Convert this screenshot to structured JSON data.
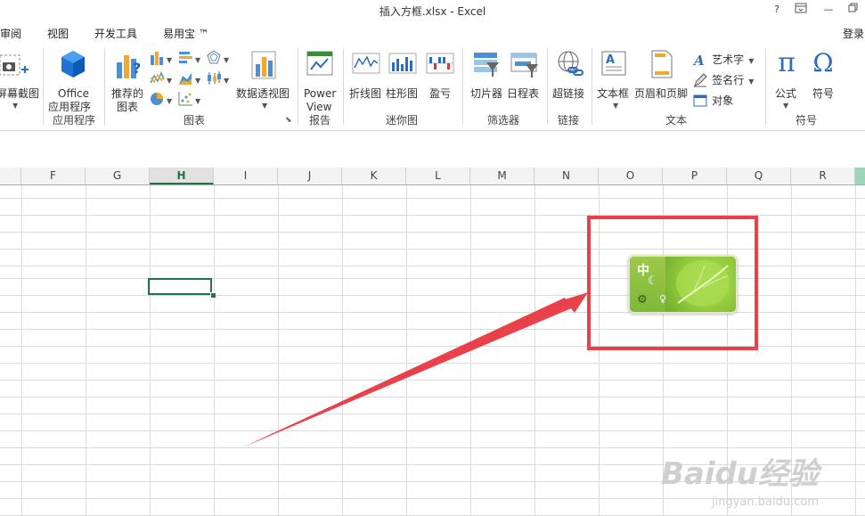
{
  "window": {
    "title": "插入方框.xlsx - Excel",
    "help": "?",
    "restore_label": "⊡",
    "minimize": "—",
    "maximize": "⧉"
  },
  "tabs": [
    {
      "label": "审阅"
    },
    {
      "label": "视图"
    },
    {
      "label": "开发工具"
    },
    {
      "label": "易用宝 ™"
    }
  ],
  "signin": "登录",
  "ribbon": {
    "screenshot": {
      "label": "屏幕截图"
    },
    "office_apps": {
      "label1": "Office",
      "label2": "应用程序"
    },
    "recommended_charts": {
      "label1": "推荐的",
      "label2": "图表"
    },
    "pivot_chart": {
      "label": "数据透视图"
    },
    "power_view": {
      "label1": "Power",
      "label2": "View"
    },
    "sparkline_line": {
      "label": "折线图"
    },
    "sparkline_column": {
      "label": "柱形图"
    },
    "sparkline_winloss": {
      "label": "盈亏"
    },
    "slicer": {
      "label": "切片器"
    },
    "timeline": {
      "label": "日程表"
    },
    "hyperlink": {
      "label": "超链接"
    },
    "textbox": {
      "label": "文本框"
    },
    "header_footer": {
      "label": "页眉和页脚"
    },
    "wordart": {
      "label": "艺术字"
    },
    "signature": {
      "label": "签名行"
    },
    "object": {
      "label": "对象"
    },
    "equation": {
      "label": "公式"
    },
    "symbol": {
      "label": "符号"
    },
    "groups": {
      "apps": "应用程序",
      "charts": "图表",
      "reports": "报告",
      "sparklines": "迷你图",
      "filters": "筛选器",
      "links": "链接",
      "text": "文本",
      "symbols": "符号"
    }
  },
  "columns": [
    "F",
    "G",
    "H",
    "I",
    "J",
    "K",
    "L",
    "M",
    "N",
    "O",
    "P",
    "Q",
    "R"
  ],
  "selected_column": "H",
  "ime_toolbar": {
    "mode": "中"
  },
  "watermark": {
    "line1": "Baidu经验",
    "line2": "jingyan.baidu.com"
  },
  "colors": {
    "accent": "#217346",
    "annotation": "#e8414a"
  }
}
